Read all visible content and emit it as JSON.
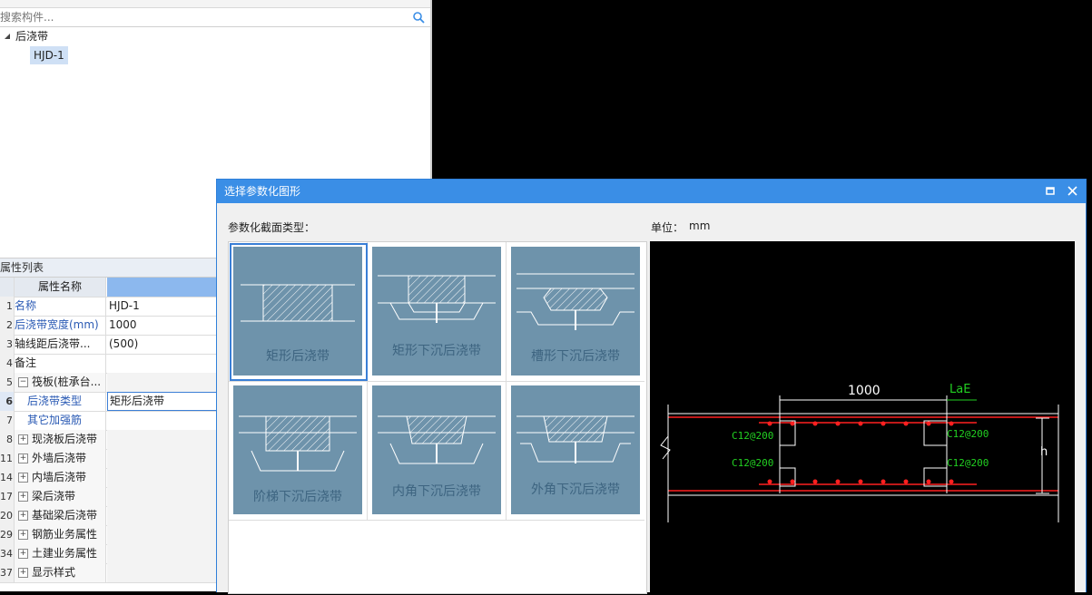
{
  "search": {
    "placeholder": "搜索构件..."
  },
  "tree": {
    "root_label": "后浇带",
    "child_label": "HJD-1"
  },
  "properties": {
    "panel_title": "属性列表",
    "header_name": "属性名称",
    "rows": [
      {
        "num": "1",
        "name": "名称",
        "value": "HJD-1"
      },
      {
        "num": "2",
        "name": "后浇带宽度(mm)",
        "value": "1000"
      },
      {
        "num": "3",
        "name": "轴线距后浇带...",
        "value": "(500)"
      },
      {
        "num": "4",
        "name": "备注",
        "value": ""
      },
      {
        "num": "5",
        "name": "筏板(桩承台...",
        "value": ""
      },
      {
        "num": "6",
        "name": "后浇带类型",
        "value": "矩形后浇带"
      },
      {
        "num": "7",
        "name": "其它加强筋",
        "value": ""
      },
      {
        "num": "8",
        "name": "现浇板后浇带",
        "value": ""
      },
      {
        "num": "11",
        "name": "外墙后浇带",
        "value": ""
      },
      {
        "num": "14",
        "name": "内墙后浇带",
        "value": ""
      },
      {
        "num": "17",
        "name": "梁后浇带",
        "value": ""
      },
      {
        "num": "20",
        "name": "基础梁后浇带",
        "value": ""
      },
      {
        "num": "29",
        "name": "钢筋业务属性",
        "value": ""
      },
      {
        "num": "34",
        "name": "土建业务属性",
        "value": ""
      },
      {
        "num": "37",
        "name": "显示样式",
        "value": ""
      }
    ]
  },
  "dialog": {
    "title": "选择参数化图形",
    "section_type_label": "参数化截面类型：",
    "unit_label": "单位：",
    "unit_value": "mm",
    "shapes": [
      {
        "label": "矩形后浇带"
      },
      {
        "label": "矩形下沉后浇带"
      },
      {
        "label": "槽形下沉后浇带"
      },
      {
        "label": "阶梯下沉后浇带"
      },
      {
        "label": "内角下沉后浇带"
      },
      {
        "label": "外角下沉后浇带"
      }
    ],
    "selected_index": 0
  },
  "preview": {
    "width_dim": "1000",
    "lae_label": "LaE",
    "h_label": "h",
    "rebar_tl": "C12@200",
    "rebar_bl": "C12@200",
    "rebar_tr": "C12@200",
    "rebar_br": "C12@200"
  },
  "colors": {
    "titlebar": "#3a8ee6",
    "card": "#6e93ab",
    "rebar_red": "#ff2020",
    "label_green": "#22d022"
  }
}
